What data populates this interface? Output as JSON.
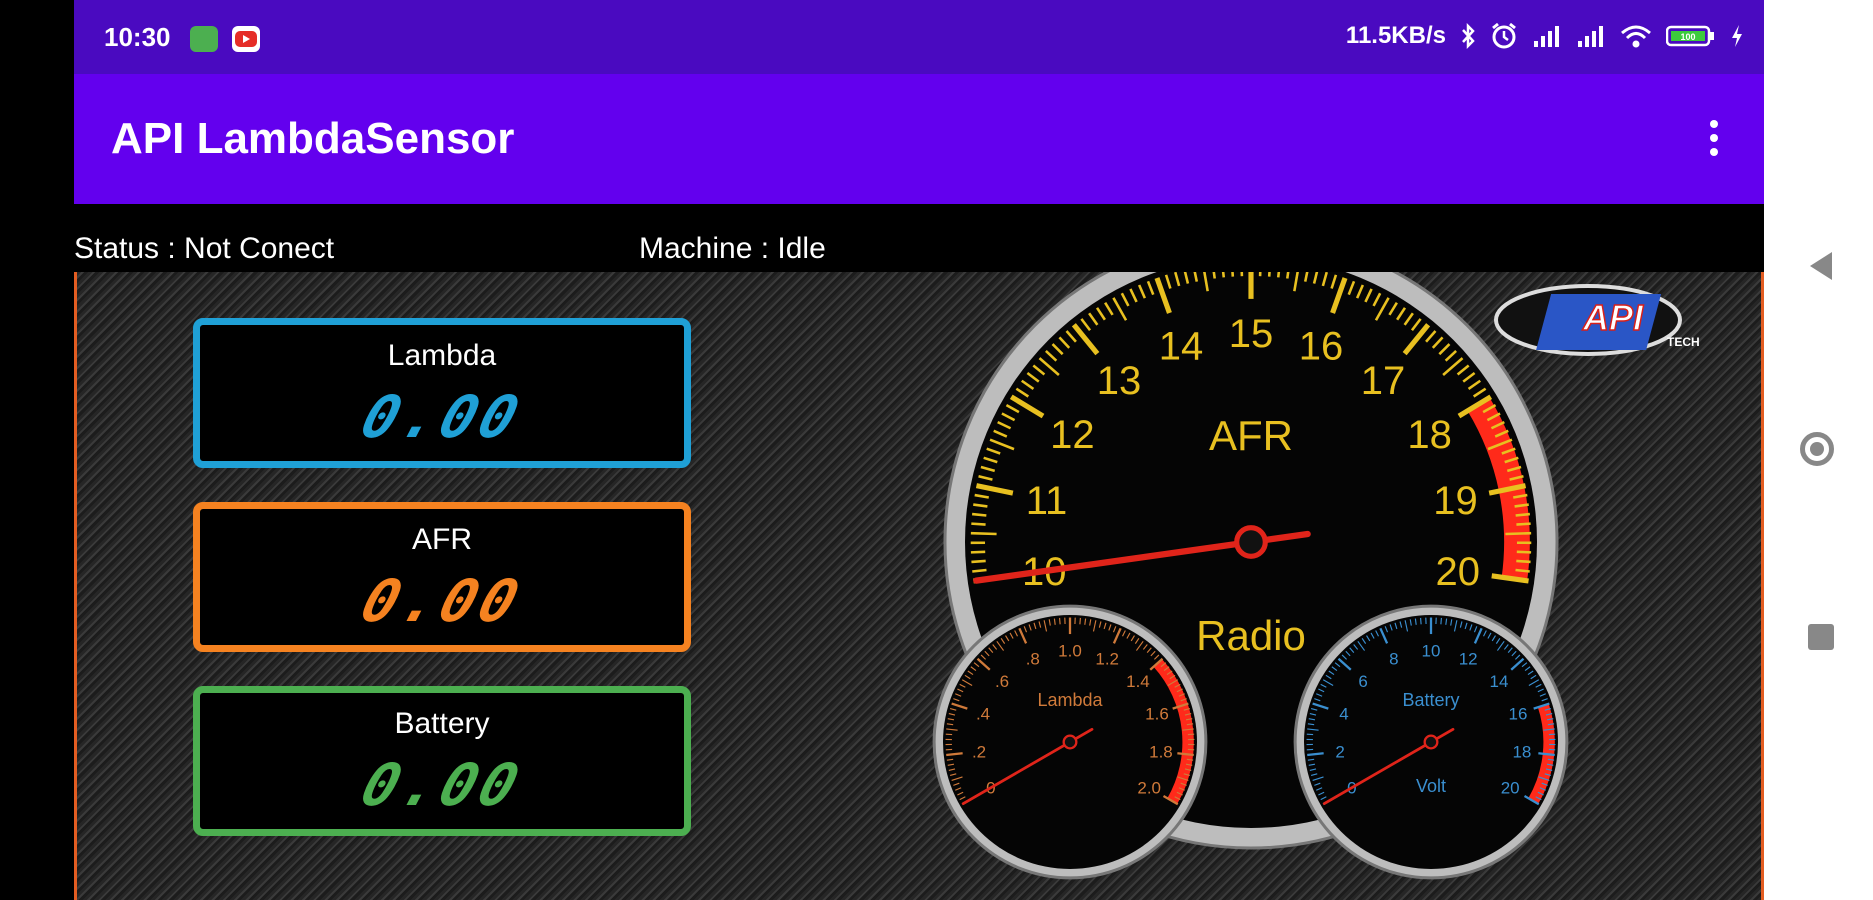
{
  "status_bar": {
    "time": "10:30",
    "network_speed": "11.5KB/s",
    "battery_level": "100"
  },
  "app": {
    "title": "API LambdaSensor"
  },
  "info": {
    "status": "Status : Not Conect",
    "machine": "Machine : Idle"
  },
  "readouts": [
    {
      "label": "Lambda",
      "value": "0.00",
      "color": "#1fa0d6"
    },
    {
      "label": "AFR",
      "value": "0.00",
      "color": "#f58220"
    },
    {
      "label": "Battery",
      "value": "0.00",
      "color": "#4caf50"
    }
  ],
  "main_gauge": {
    "title": "AFR",
    "subtitle": "Radio",
    "ticks": [
      "10",
      "11",
      "12",
      "13",
      "14",
      "15",
      "16",
      "17",
      "18",
      "19",
      "20"
    ],
    "min": 10,
    "max": 20,
    "value": 10.0,
    "redline_start": 18,
    "label_color": "#e8c020"
  },
  "lambda_gauge": {
    "title": "Lambda",
    "ticks": [
      "0",
      ".2",
      ".4",
      ".6",
      ".8",
      "1.0",
      "1.2",
      "1.4",
      "1.6",
      "1.8",
      "2.0"
    ],
    "min": 0,
    "max": 2,
    "value": 0,
    "redline_start": 1.4,
    "label_color": "#d07a3a"
  },
  "battery_gauge": {
    "title": "Battery",
    "unit": "Volt",
    "ticks": [
      "0",
      "2",
      "4",
      "6",
      "8",
      "10",
      "12",
      "14",
      "16",
      "18",
      "20"
    ],
    "min": 0,
    "max": 20,
    "value": 0,
    "redline_start": 16,
    "label_color": "#3a8fd0"
  },
  "logo": {
    "text": "API",
    "subtext": "TECH"
  }
}
